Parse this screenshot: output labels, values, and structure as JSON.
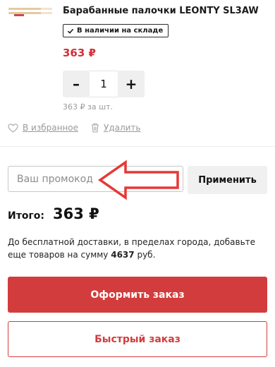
{
  "product": {
    "title": "Барабанные палочки LEONTY SL3AW",
    "stock_badge": "В наличии на складе",
    "price": "363 ₽",
    "quantity": "1",
    "decrement_label": "–",
    "increment_label": "+",
    "unit_price": "363 ₽ за шт.",
    "favorite_label": "В избранное",
    "delete_label": "Удалить",
    "icons": {
      "stock": "checkmark-icon",
      "favorite": "heart-icon",
      "delete": "trash-icon"
    }
  },
  "promo": {
    "placeholder": "Ваш промокод",
    "value": "",
    "apply_label": "Применить"
  },
  "summary": {
    "total_label": "Итого:",
    "total_value": "363 ₽",
    "delivery_text_before": "До бесплатной доставки, в пределах города, добавьте еще товаров на сумму ",
    "delivery_amount": "4637",
    "delivery_text_after": " руб."
  },
  "actions": {
    "checkout_label": "Оформить заказ",
    "quick_order_label": "Быстрый заказ"
  },
  "colors": {
    "accent": "#d23c3c",
    "price": "#d32f36",
    "muted_text": "#9a9a9a",
    "annotation_arrow": "#e53935"
  }
}
